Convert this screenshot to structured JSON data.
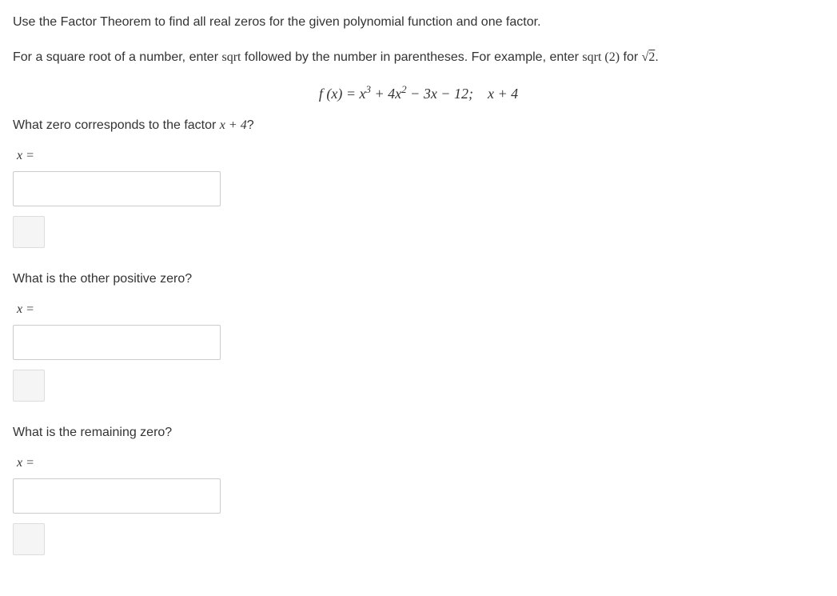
{
  "instructions": {
    "line1": "Use the Factor Theorem to find all real zeros for the given polynomial function and one factor.",
    "line2_part1": "For a square root of a number, enter ",
    "line2_sqrt": "sqrt",
    "line2_part2": " followed by the number in parentheses. For example, enter ",
    "line2_sqrt2": "sqrt (2)",
    "line2_part3": " for "
  },
  "equation": {
    "lhs": "f (x) = x",
    "exp1": "3",
    "mid1": " + 4x",
    "exp2": "2",
    "mid2": " − 3x − 12;",
    "factor": "x + 4"
  },
  "questions": {
    "q1": {
      "text_pre": "What zero corresponds to the factor ",
      "text_math": "x + 4",
      "text_post": "?",
      "label": "x ="
    },
    "q2": {
      "text": "What is the other positive zero?",
      "label": "x ="
    },
    "q3": {
      "text": "What is the remaining zero?",
      "label": "x ="
    }
  }
}
